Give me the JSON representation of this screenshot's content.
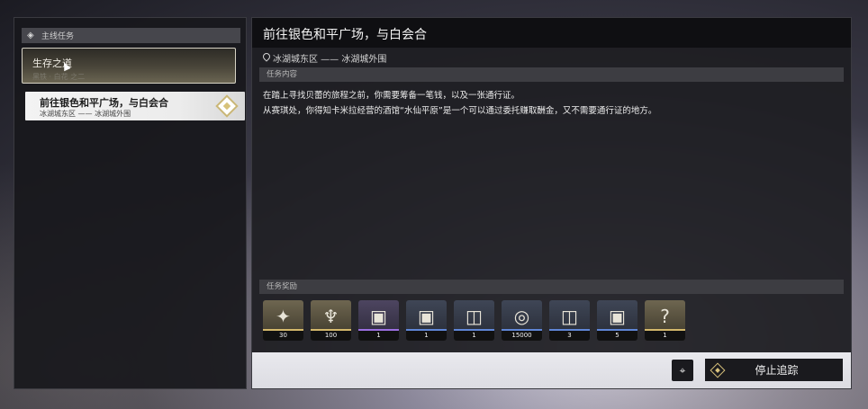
{
  "sidebar": {
    "header": "主线任务",
    "quest": {
      "title": "生存之道",
      "subtitle": "黑铁 · 白花 之二"
    },
    "active_step": {
      "title": "前往银色和平广场，与白会合",
      "location": "冰湖城东区 —— 冰湖城外围"
    }
  },
  "detail": {
    "title": "前往银色和平广场，与白会合",
    "location": "冰湖城东区 —— 冰湖城外围",
    "content_header": "任务内容",
    "description": [
      "在踏上寻找贝蕾的旅程之前，你需要筹备一笔钱，以及一张通行证。",
      "从赛琪处，你得知卡米拉经营的酒馆“水仙平原”是一个可以通过委托赚取酬金，又不需要通行证的地方。"
    ],
    "rewards_header": "任务奖励",
    "rewards": [
      {
        "icon": "crystal-icon",
        "glyph": "✦",
        "count": "30",
        "rarity": "gold"
      },
      {
        "icon": "antler-emblem-icon",
        "glyph": "♆",
        "count": "100",
        "rarity": "gold"
      },
      {
        "icon": "cat-tome-purple-icon",
        "glyph": "▣",
        "count": "1",
        "rarity": "purple"
      },
      {
        "icon": "cat-tome-blue-icon",
        "glyph": "▣",
        "count": "1",
        "rarity": "blue"
      },
      {
        "icon": "rune-box-icon",
        "glyph": "◫",
        "count": "1",
        "rarity": "blue"
      },
      {
        "icon": "coin-icon",
        "glyph": "◎",
        "count": "15000",
        "rarity": "blue"
      },
      {
        "icon": "rune-box-icon",
        "glyph": "◫",
        "count": "3",
        "rarity": "blue"
      },
      {
        "icon": "cat-tome-blue-icon",
        "glyph": "▣",
        "count": "5",
        "rarity": "blue"
      },
      {
        "icon": "mystery-item-icon",
        "glyph": "?",
        "count": "1",
        "rarity": "gold"
      }
    ],
    "stop_tracking_label": "停止追踪"
  }
}
